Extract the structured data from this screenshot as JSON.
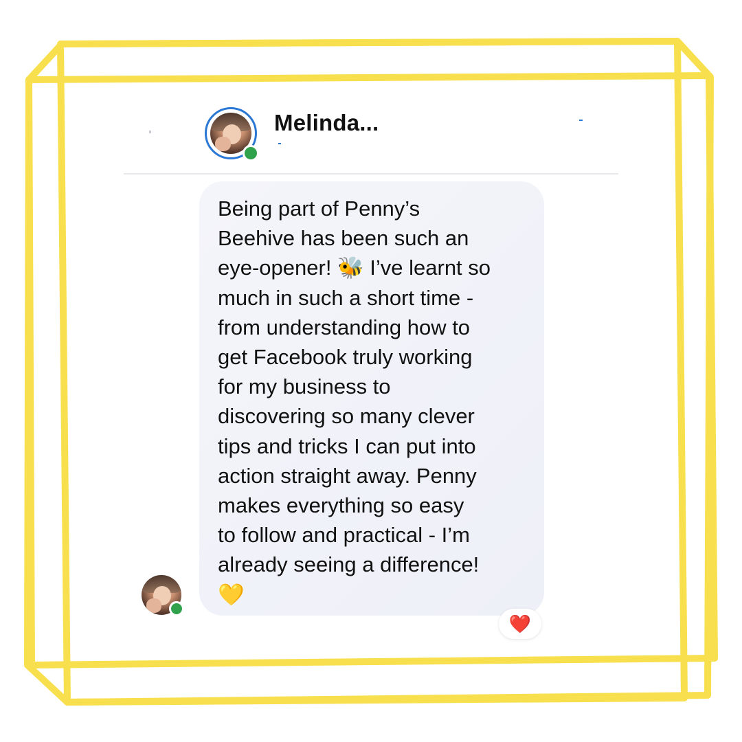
{
  "frame": {
    "color": "#f8df4d"
  },
  "header": {
    "contact_name": "Melinda...",
    "avatar_ring_color": "#2b78d4",
    "online_status_color": "#31a24c"
  },
  "message": {
    "text": "Being part of Penny’s\nBeehive has been such an\neye-opener! 🐝 I’ve learnt so\nmuch in such a short time -\nfrom understanding how to\nget Facebook truly working\nfor my business to\ndiscovering so many clever\ntips and tricks I can put into\naction straight away. Penny\nmakes everything so easy\nto follow and practical - I’m\nalready seeing a difference!\n💛",
    "bubble_color": "#f1f2f8"
  },
  "reaction": {
    "emoji": "❤️",
    "icon": "heart-icon"
  },
  "icons": {
    "avatar": "profile-photo-icon",
    "online": "online-status-dot-icon"
  }
}
